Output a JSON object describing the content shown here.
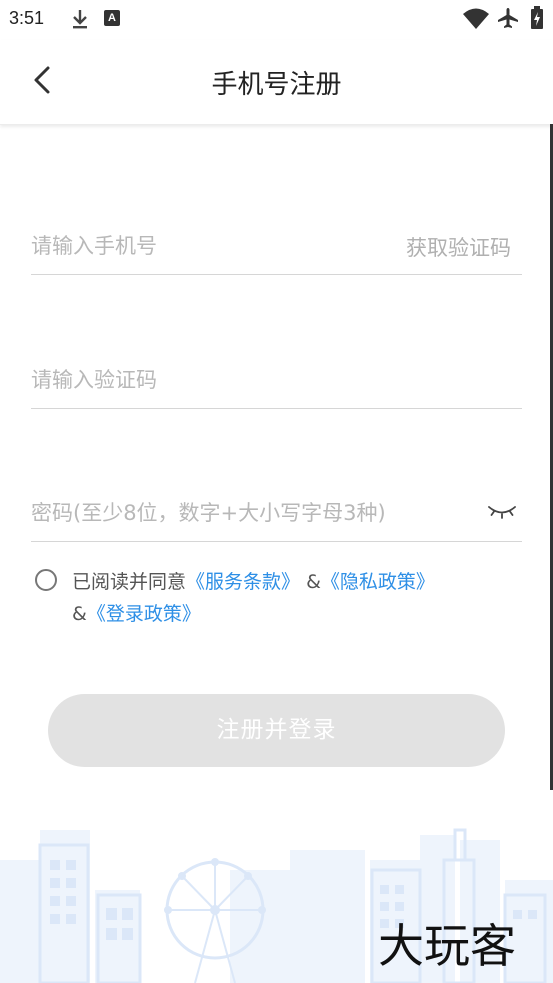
{
  "status_bar": {
    "time": "3:51",
    "notification_letter": "A",
    "icons": [
      "download-icon",
      "a-notification-icon",
      "wifi-icon",
      "airplane-icon",
      "battery-icon"
    ]
  },
  "header": {
    "title": "手机号注册",
    "back_icon": "chevron-left-icon"
  },
  "form": {
    "phone_placeholder": "请输入手机号",
    "get_code_label": "获取验证码",
    "code_placeholder": "请输入验证码",
    "password_placeholder": "密码(至少8位，数字+大小写字母3种)",
    "password_toggle_icon": "eye-closed-icon"
  },
  "agreement": {
    "prefix": "已阅读并同意",
    "terms_link": "《服务条款》",
    "separator_1": "&",
    "privacy_link": "《隐私政策》",
    "separator_2": "&",
    "login_link": "《登录政策》"
  },
  "submit_label": "注册并登录",
  "watermark_text": "大玩客",
  "colors": {
    "link": "#2e8fe6",
    "button_disabled": "#e2e2e2",
    "placeholder": "#b8b8b8",
    "skyline": "#dfeaf9"
  }
}
